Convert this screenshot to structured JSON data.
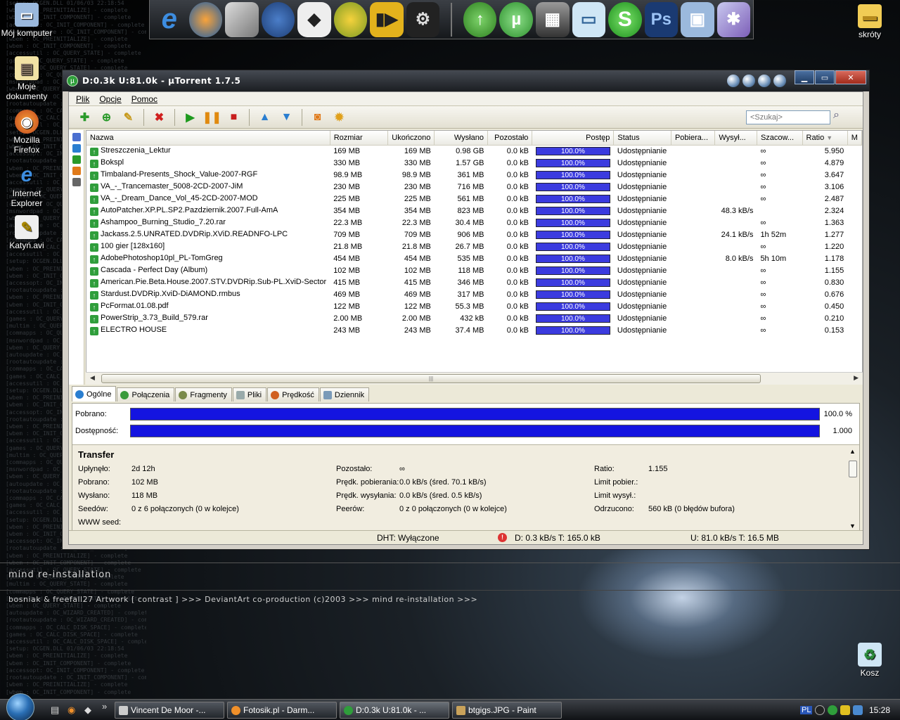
{
  "desktop": {
    "icons": [
      {
        "label": "Mój komputer",
        "icon": "computer-icon"
      },
      {
        "label": "Moje dokumenty",
        "icon": "documents-icon"
      },
      {
        "label": "Mozilla Firefox",
        "icon": "firefox-icon"
      },
      {
        "label": "Internet Explorer",
        "icon": "ie-icon"
      },
      {
        "label": "Katyń.avi",
        "icon": "video-file-icon"
      },
      {
        "label": "skróty",
        "icon": "folder-icon"
      },
      {
        "label": "Kosz",
        "icon": "recycle-bin-icon"
      }
    ],
    "wallpaper_title": "mind re-installation",
    "wallpaper_credits": "bosniak & freefall27 Artwork [ contrast ] >>> DeviantArt co-production (c)2003 >>> mind re-installation >>>",
    "log_lines": [
      "[setup: OCGEN.DLL 01/06/03 22:18:54",
      "[wbem : OC_PREINITIALIZE] - complete",
      "[wbem : OC_INIT_COMPONENT] - complete",
      "[accessopt: OC_INIT_COMPONENT] - complete",
      "[rootautoupdate : OC_INIT_COMPONENT] - complete",
      "[wbem : OC_PREINITIALIZE] - complete",
      "[wbem : OC_INIT_COMPONENT] - complete",
      "[accessutil : OC_QUERY_STATE] - complete",
      "[games : OC_QUERY_STATE] - complete",
      "[multim : OC_QUERY_STATE] - complete",
      "[commapps : OC_QUERY_STATE] - complete",
      "[msnwordpad : OC_QUERY_STATE] - complete",
      "[wbem : OC_QUERY_STATE] - complete",
      "[autoupdate : OC_WIZARD_CREATED] - complete",
      "[rootautoupdate : OC_WIZARD_CREATED] - complete",
      "[commapps : OC_CALC_DISK_SPACE] - complete",
      "[games : OC_CALC_DISK_SPACE] - complete",
      "[accessutil : OC_CALC_DISK_SPACE] - complete"
    ]
  },
  "dock": {
    "icons": [
      "ie-icon",
      "firefox-icon",
      "files-icon",
      "thunderbird-icon",
      "alien-icon",
      "gaim-icon",
      "player-icon",
      "steam-icon",
      "download-icon",
      "utorrent-icon",
      "film-icon",
      "chat-icon",
      "skype-icon",
      "photoshop-icon",
      "monitor-icon",
      "settings-icon"
    ],
    "ps_label": "Ps",
    "s_label": "S",
    "e_label": "e"
  },
  "window": {
    "title": "D:0.3k U:81.0k - µTorrent 1.7.5",
    "menu": [
      "Plik",
      "Opcje",
      "Pomoc"
    ],
    "search_placeholder": "<Szukaj>",
    "columns": [
      "Nazwa",
      "Rozmiar",
      "Ukończono",
      "Wysłano",
      "Pozostało",
      "Postęp",
      "Status",
      "Pobiera...",
      "Wysył...",
      "Szacow...",
      "Ratio",
      "M"
    ],
    "rows": [
      {
        "name": "Streszczenia_Lektur",
        "size": "169 MB",
        "done": "169 MB",
        "sent": "0.98 GB",
        "left": "0.0 kB",
        "progress": "100.0%",
        "status": "Udostępnianie",
        "down": "",
        "up": "",
        "eta": "∞",
        "ratio": "5.950"
      },
      {
        "name": "Bokspl",
        "size": "330 MB",
        "done": "330 MB",
        "sent": "1.57 GB",
        "left": "0.0 kB",
        "progress": "100.0%",
        "status": "Udostępnianie",
        "down": "",
        "up": "",
        "eta": "∞",
        "ratio": "4.879"
      },
      {
        "name": "Timbaland-Presents_Shock_Value-2007-RGF",
        "size": "98.9 MB",
        "done": "98.9 MB",
        "sent": "361 MB",
        "left": "0.0 kB",
        "progress": "100.0%",
        "status": "Udostępnianie",
        "down": "",
        "up": "",
        "eta": "∞",
        "ratio": "3.647"
      },
      {
        "name": "VA_-_Trancemaster_5008-2CD-2007-JiM",
        "size": "230 MB",
        "done": "230 MB",
        "sent": "716 MB",
        "left": "0.0 kB",
        "progress": "100.0%",
        "status": "Udostępnianie",
        "down": "",
        "up": "",
        "eta": "∞",
        "ratio": "3.106"
      },
      {
        "name": "VA_-_Dream_Dance_Vol_45-2CD-2007-MOD",
        "size": "225 MB",
        "done": "225 MB",
        "sent": "561 MB",
        "left": "0.0 kB",
        "progress": "100.0%",
        "status": "Udostępnianie",
        "down": "",
        "up": "",
        "eta": "∞",
        "ratio": "2.487"
      },
      {
        "name": "AutoPatcher.XP.PL.SP2.Pazdziernik.2007.Full-AmA",
        "size": "354 MB",
        "done": "354 MB",
        "sent": "823 MB",
        "left": "0.0 kB",
        "progress": "100.0%",
        "status": "Udostępnianie",
        "down": "",
        "up": "48.3 kB/s",
        "eta": "",
        "ratio": "2.324"
      },
      {
        "name": "Ashampoo_Burning_Studio_7.20.rar",
        "size": "22.3 MB",
        "done": "22.3 MB",
        "sent": "30.4 MB",
        "left": "0.0 kB",
        "progress": "100.0%",
        "status": "Udostępnianie",
        "down": "",
        "up": "",
        "eta": "∞",
        "ratio": "1.363"
      },
      {
        "name": "Jackass.2.5.UNRATED.DVDRip.XViD.READNFO-LPC",
        "size": "709 MB",
        "done": "709 MB",
        "sent": "906 MB",
        "left": "0.0 kB",
        "progress": "100.0%",
        "status": "Udostępnianie",
        "down": "",
        "up": "24.1 kB/s",
        "eta": "1h 52m",
        "ratio": "1.277"
      },
      {
        "name": "100 gier [128x160]",
        "size": "21.8 MB",
        "done": "21.8 MB",
        "sent": "26.7 MB",
        "left": "0.0 kB",
        "progress": "100.0%",
        "status": "Udostępnianie",
        "down": "",
        "up": "",
        "eta": "∞",
        "ratio": "1.220"
      },
      {
        "name": "AdobePhotoshop10pl_PL-TomGreg",
        "size": "454 MB",
        "done": "454 MB",
        "sent": "535 MB",
        "left": "0.0 kB",
        "progress": "100.0%",
        "status": "Udostępnianie",
        "down": "",
        "up": "8.0 kB/s",
        "eta": "5h 10m",
        "ratio": "1.178"
      },
      {
        "name": "Cascada - Perfect Day (Album)",
        "size": "102 MB",
        "done": "102 MB",
        "sent": "118 MB",
        "left": "0.0 kB",
        "progress": "100.0%",
        "status": "Udostępnianie",
        "down": "",
        "up": "",
        "eta": "∞",
        "ratio": "1.155"
      },
      {
        "name": "American.Pie.Beta.House.2007.STV.DVDRip.Sub-PL.XviD-Sector",
        "size": "415 MB",
        "done": "415 MB",
        "sent": "346 MB",
        "left": "0.0 kB",
        "progress": "100.0%",
        "status": "Udostępnianie",
        "down": "",
        "up": "",
        "eta": "∞",
        "ratio": "0.830"
      },
      {
        "name": "Stardust.DVDRip.XviD-DiAMOND.rmbus",
        "size": "469 MB",
        "done": "469 MB",
        "sent": "317 MB",
        "left": "0.0 kB",
        "progress": "100.0%",
        "status": "Udostępnianie",
        "down": "",
        "up": "",
        "eta": "∞",
        "ratio": "0.676"
      },
      {
        "name": "PcFormat.01.08.pdf",
        "size": "122 MB",
        "done": "122 MB",
        "sent": "55.3 MB",
        "left": "0.0 kB",
        "progress": "100.0%",
        "status": "Udostępnianie",
        "down": "",
        "up": "",
        "eta": "∞",
        "ratio": "0.450"
      },
      {
        "name": "PowerStrip_3.73_Build_579.rar",
        "size": "2.00 MB",
        "done": "2.00 MB",
        "sent": "432 kB",
        "left": "0.0 kB",
        "progress": "100.0%",
        "status": "Udostępnianie",
        "down": "",
        "up": "",
        "eta": "∞",
        "ratio": "0.210"
      },
      {
        "name": "ELECTRO HOUSE",
        "size": "243 MB",
        "done": "243 MB",
        "sent": "37.4 MB",
        "left": "0.0 kB",
        "progress": "100.0%",
        "status": "Udostępnianie",
        "down": "",
        "up": "",
        "eta": "∞",
        "ratio": "0.153"
      }
    ],
    "tabs": [
      "Ogólne",
      "Połączenia",
      "Fragmenty",
      "Pliki",
      "Prędkość",
      "Dziennik"
    ],
    "downloaded_label": "Pobrano:",
    "downloaded_value": "100.0 %",
    "availability_label": "Dostępność:",
    "availability_value": "1.000",
    "transfer_title": "Transfer",
    "transfer": {
      "elapsed_label": "Upłynęło:",
      "elapsed": "2d 12h",
      "downloaded_label": "Pobrano:",
      "downloaded": "102 MB",
      "uploaded_label": "Wysłano:",
      "uploaded": "118 MB",
      "seeds_label": "Seedów:",
      "seeds": "0 z 6 połączonych (0 w kolejce)",
      "webseed_label": "WWW seed:",
      "remaining_label": "Pozostało:",
      "remaining": "∞",
      "dl_speed_label": "Prędk. pobierania:",
      "dl_speed": "0.0 kB/s (śred. 70.1 kB/s)",
      "ul_speed_label": "Prędk. wysyłania:",
      "ul_speed": "0.0 kB/s (śred. 0.5 kB/s)",
      "peers_label": "Peerów:",
      "peers": "0 z 0 połączonych (0 w kolejce)",
      "ratio_label": "Ratio:",
      "ratio": "1.155",
      "dl_limit_label": "Limit pobier.:",
      "ul_limit_label": "Limit wysył.:",
      "wasted_label": "Odrzucono:",
      "wasted": "560 kB (0 błędów bufora)"
    },
    "status": {
      "dht": "DHT: Wyłączone",
      "down": "D: 0.3 kB/s T: 165.0 kB",
      "up": "U: 81.0 kB/s T: 16.5 MB"
    }
  },
  "taskbar": {
    "tasks": [
      {
        "label": "Vincent De Moor -...",
        "icon": "winamp-icon"
      },
      {
        "label": "Fotosik.pl - Darm...",
        "icon": "firefox-icon"
      },
      {
        "label": "D:0.3k U:81.0k - ...",
        "icon": "utorrent-icon"
      },
      {
        "label": "btgigs.JPG - Paint",
        "icon": "paint-icon"
      }
    ],
    "tray_lang": "PL",
    "clock": "15:28",
    "chevron": "»"
  },
  "colors": {
    "progress": "#3b3bdf",
    "pbar": "#1414e0",
    "torrent_icon": "#2f9e3b"
  }
}
